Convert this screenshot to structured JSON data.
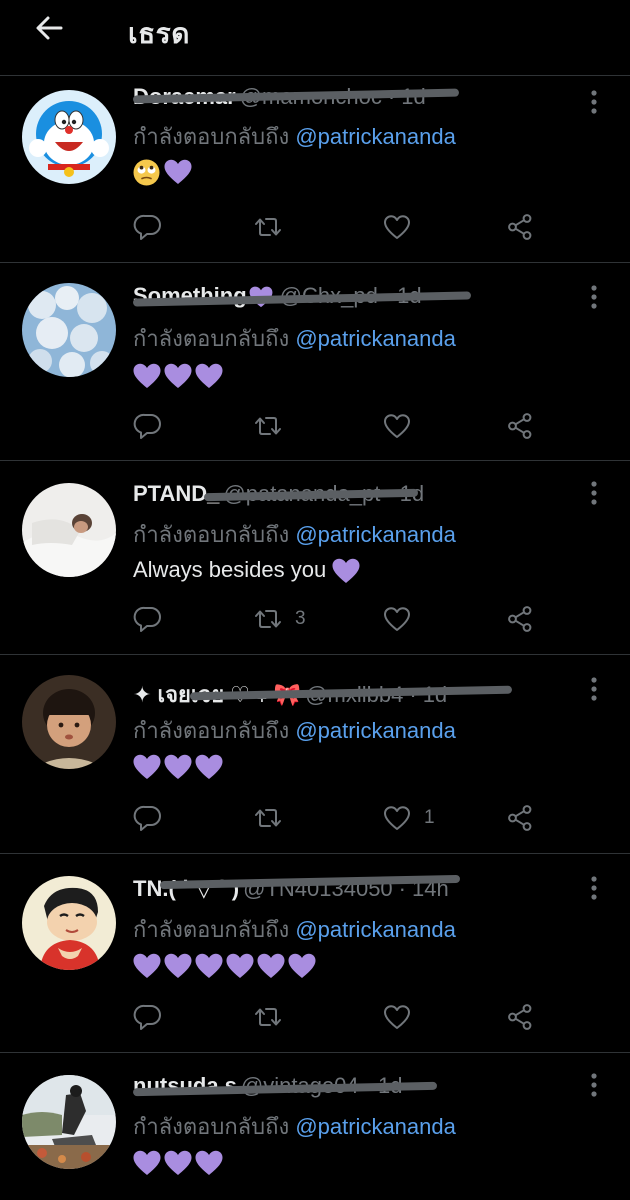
{
  "header": {
    "title": "เธรด"
  },
  "colors": {
    "background": "#000000",
    "mention": "#5aa0ec",
    "muted": "#71767b",
    "heart": "#a98de0"
  },
  "tweets": [
    {
      "name": "Doraemar",
      "handle": "@mamonchoc",
      "time": "1d",
      "reply_prefix": "กำลังตอบกลับถึง ",
      "mention": "@patrickananda",
      "emoji": [
        "face-with-rolling-eyes",
        "purple-heart"
      ],
      "text": "",
      "retweets": "",
      "likes": ""
    },
    {
      "name": "Something",
      "handle": "@Chx_pd",
      "time": "1d",
      "reply_prefix": "กำลังตอบกลับถึง ",
      "mention": "@patrickananda",
      "emoji": [
        "purple-heart",
        "purple-heart",
        "purple-heart"
      ],
      "text": "",
      "retweets": "",
      "likes": ""
    },
    {
      "name": "PTAND_",
      "handle": "@patananda_pt",
      "time": "1d",
      "reply_prefix": "กำลังตอบกลับถึง ",
      "mention": "@patrickananda",
      "emoji": [
        "purple-heart"
      ],
      "text": "Always besides you ",
      "retweets": "3",
      "likes": ""
    },
    {
      "name": "✦ เจยเจย ♡ ₊ 🎀",
      "handle": "@mxllbb4",
      "time": "1d",
      "reply_prefix": "กำลังตอบกลับถึง ",
      "mention": "@patrickananda",
      "emoji": [
        "purple-heart",
        "purple-heart",
        "purple-heart"
      ],
      "text": "",
      "retweets": "",
      "likes": "1"
    },
    {
      "name": "TN.( ˙ ▽ ˙ )",
      "handle": "@TN40134050",
      "time": "14h",
      "reply_prefix": "กำลังตอบกลับถึง ",
      "mention": "@patrickananda",
      "emoji": [
        "purple-heart",
        "purple-heart",
        "purple-heart",
        "purple-heart",
        "purple-heart",
        "purple-heart"
      ],
      "text": "",
      "retweets": "",
      "likes": ""
    },
    {
      "name": "nutsuda.s",
      "handle": "@vintage04",
      "time": "1d",
      "reply_prefix": "กำลังตอบกลับถึง ",
      "mention": "@patrickananda",
      "emoji": [
        "purple-heart",
        "purple-heart",
        "purple-heart"
      ],
      "text": "",
      "retweets": "",
      "likes": ""
    }
  ]
}
